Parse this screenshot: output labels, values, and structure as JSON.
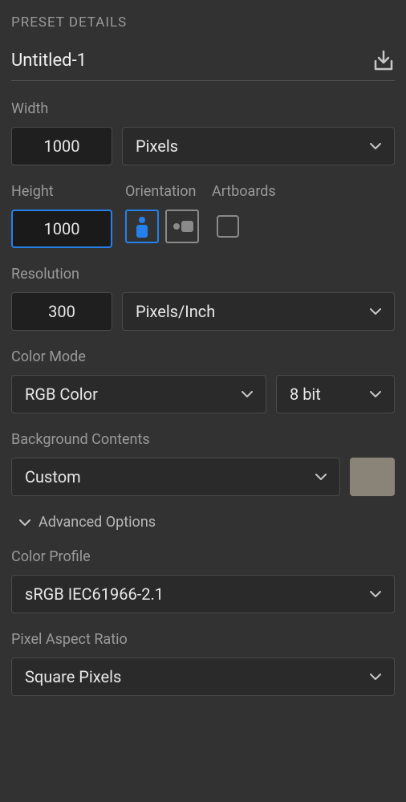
{
  "panel": {
    "title": "PRESET DETAILS"
  },
  "preset": {
    "name": "Untitled-1"
  },
  "width": {
    "label": "Width",
    "value": "1000",
    "unit": "Pixels"
  },
  "height": {
    "label": "Height",
    "value": "1000"
  },
  "orientation": {
    "label": "Orientation",
    "value": "portrait"
  },
  "artboards": {
    "label": "Artboards",
    "checked": false
  },
  "resolution": {
    "label": "Resolution",
    "value": "300",
    "unit": "Pixels/Inch"
  },
  "colorMode": {
    "label": "Color Mode",
    "value": "RGB Color",
    "depth": "8 bit"
  },
  "background": {
    "label": "Background Contents",
    "value": "Custom",
    "swatch": "#8a8377"
  },
  "advanced": {
    "label": "Advanced Options",
    "expanded": true
  },
  "colorProfile": {
    "label": "Color Profile",
    "value": "sRGB IEC61966-2.1"
  },
  "pixelAspect": {
    "label": "Pixel Aspect Ratio",
    "value": "Square Pixels"
  }
}
